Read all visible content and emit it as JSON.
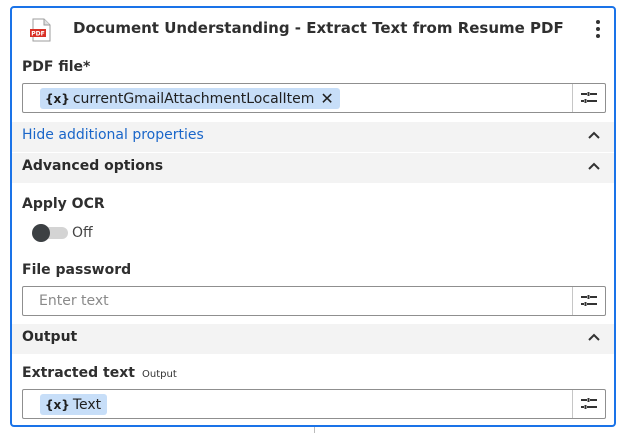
{
  "header": {
    "title": "Document Understanding - Extract Text from Resume PDF",
    "icon": "pdf-file-icon",
    "menu_icon": "kebab-menu-icon"
  },
  "pdf_file": {
    "label": "PDF file*",
    "token_icon": "{x}",
    "token_text": "currentGmailAttachmentLocalItem",
    "remove": "✕"
  },
  "toggle_props": {
    "label": "Hide additional properties"
  },
  "advanced": {
    "label": "Advanced options"
  },
  "apply_ocr": {
    "label": "Apply OCR",
    "state_text": "Off"
  },
  "file_password": {
    "label": "File password",
    "placeholder": "Enter text"
  },
  "output": {
    "label": "Output"
  },
  "extracted_text": {
    "label": "Extracted text",
    "tag": "Output",
    "token_icon": "{x}",
    "token_text": "Text"
  },
  "colors": {
    "accent": "#1a73e8",
    "link": "#1a66c9",
    "token_bg": "#c7def8",
    "section_bg": "#f3f3f3"
  }
}
